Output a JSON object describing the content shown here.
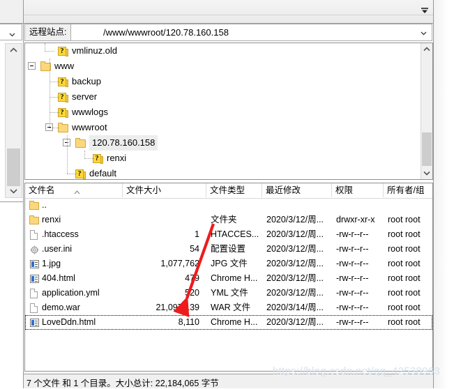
{
  "window": {
    "toolbar": {
      "collapse_icon": "collapse-down-icon"
    },
    "address": {
      "label": "远程站点:",
      "value": "/www/wwwroot/120.78.160.158",
      "dropdown_icon": "chevron-down-icon"
    }
  },
  "background_panel": {
    "dropdown_icon": "chevron-down-icon"
  },
  "tree": {
    "items": [
      {
        "label": "vmlinuz.old",
        "icon": "folder-unknown-icon",
        "indent": 1,
        "expander": "none",
        "selected": false
      },
      {
        "label": "www",
        "icon": "folder-open-icon",
        "indent": 0,
        "expander": "minus",
        "selected": false
      },
      {
        "label": "backup",
        "icon": "folder-unknown-icon",
        "indent": 1,
        "expander": "none",
        "selected": false
      },
      {
        "label": "server",
        "icon": "folder-unknown-icon",
        "indent": 1,
        "expander": "none",
        "selected": false
      },
      {
        "label": "wwwlogs",
        "icon": "folder-unknown-icon",
        "indent": 1,
        "expander": "none",
        "selected": false
      },
      {
        "label": "wwwroot",
        "icon": "folder-open-icon",
        "indent": 1,
        "expander": "minus",
        "selected": false
      },
      {
        "label": "120.78.160.158",
        "icon": "folder-open-icon",
        "indent": 2,
        "expander": "minus",
        "selected": true
      },
      {
        "label": "renxi",
        "icon": "folder-unknown-icon",
        "indent": 3,
        "expander": "none",
        "selected": false
      },
      {
        "label": "default",
        "icon": "folder-unknown-icon",
        "indent": 2,
        "expander": "none",
        "selected": false
      }
    ]
  },
  "file_list": {
    "columns": [
      {
        "label": "文件名",
        "sort": "asc"
      },
      {
        "label": "文件大小",
        "sort": "none"
      },
      {
        "label": "文件类型",
        "sort": "none"
      },
      {
        "label": "最近修改",
        "sort": "none"
      },
      {
        "label": "权限",
        "sort": "none"
      },
      {
        "label": "所有者/组",
        "sort": "none"
      }
    ],
    "rows": [
      {
        "name": "..",
        "icon": "folder-icon",
        "size": "",
        "type": "",
        "modified": "",
        "perm": "",
        "owner": "",
        "focused": false
      },
      {
        "name": "renxi",
        "icon": "folder-icon",
        "size": "",
        "type": "文件夹",
        "modified": "2020/3/12/周...",
        "perm": "drwxr-xr-x",
        "owner": "root root",
        "focused": false
      },
      {
        "name": ".htaccess",
        "icon": "document-icon",
        "size": "1",
        "type": "HTACCES...",
        "modified": "2020/3/12/周...",
        "perm": "-rw-r--r--",
        "owner": "root root",
        "focused": false
      },
      {
        "name": ".user.ini",
        "icon": "settings-gear-icon",
        "size": "54",
        "type": "配置设置",
        "modified": "2020/3/12/周...",
        "perm": "-rw-r--r--",
        "owner": "root root",
        "focused": false
      },
      {
        "name": "1.jpg",
        "icon": "image-file-icon",
        "size": "1,077,762",
        "type": "JPG 文件",
        "modified": "2020/3/12/周...",
        "perm": "-rw-r--r--",
        "owner": "root root",
        "focused": false
      },
      {
        "name": "404.html",
        "icon": "image-file-icon",
        "size": "479",
        "type": "Chrome H...",
        "modified": "2020/3/12/周...",
        "perm": "-rw-r--r--",
        "owner": "root root",
        "focused": false
      },
      {
        "name": "application.yml",
        "icon": "document-icon",
        "size": "520",
        "type": "YML 文件",
        "modified": "2020/3/12/周...",
        "perm": "-rw-r--r--",
        "owner": "root root",
        "focused": false
      },
      {
        "name": "demo.war",
        "icon": "document-icon",
        "size": "21,097,139",
        "type": "WAR 文件",
        "modified": "2020/3/14/周...",
        "perm": "-rw-r--r--",
        "owner": "root root",
        "focused": false
      },
      {
        "name": "LoveDdn.html",
        "icon": "image-file-icon",
        "size": "8,110",
        "type": "Chrome H...",
        "modified": "2020/3/12/周...",
        "perm": "-rw-r--r--",
        "owner": "root root",
        "focused": true
      }
    ]
  },
  "status": {
    "text": "7 个文件 和 1 个目录。大小总计: 22,184,065 字节"
  },
  "watermark": {
    "text": "https://blog.csdn.net/qq_42538963"
  },
  "annotation": {
    "color": "#ee1c1c",
    "shape": "arrow-pointing-to-demo-war"
  }
}
